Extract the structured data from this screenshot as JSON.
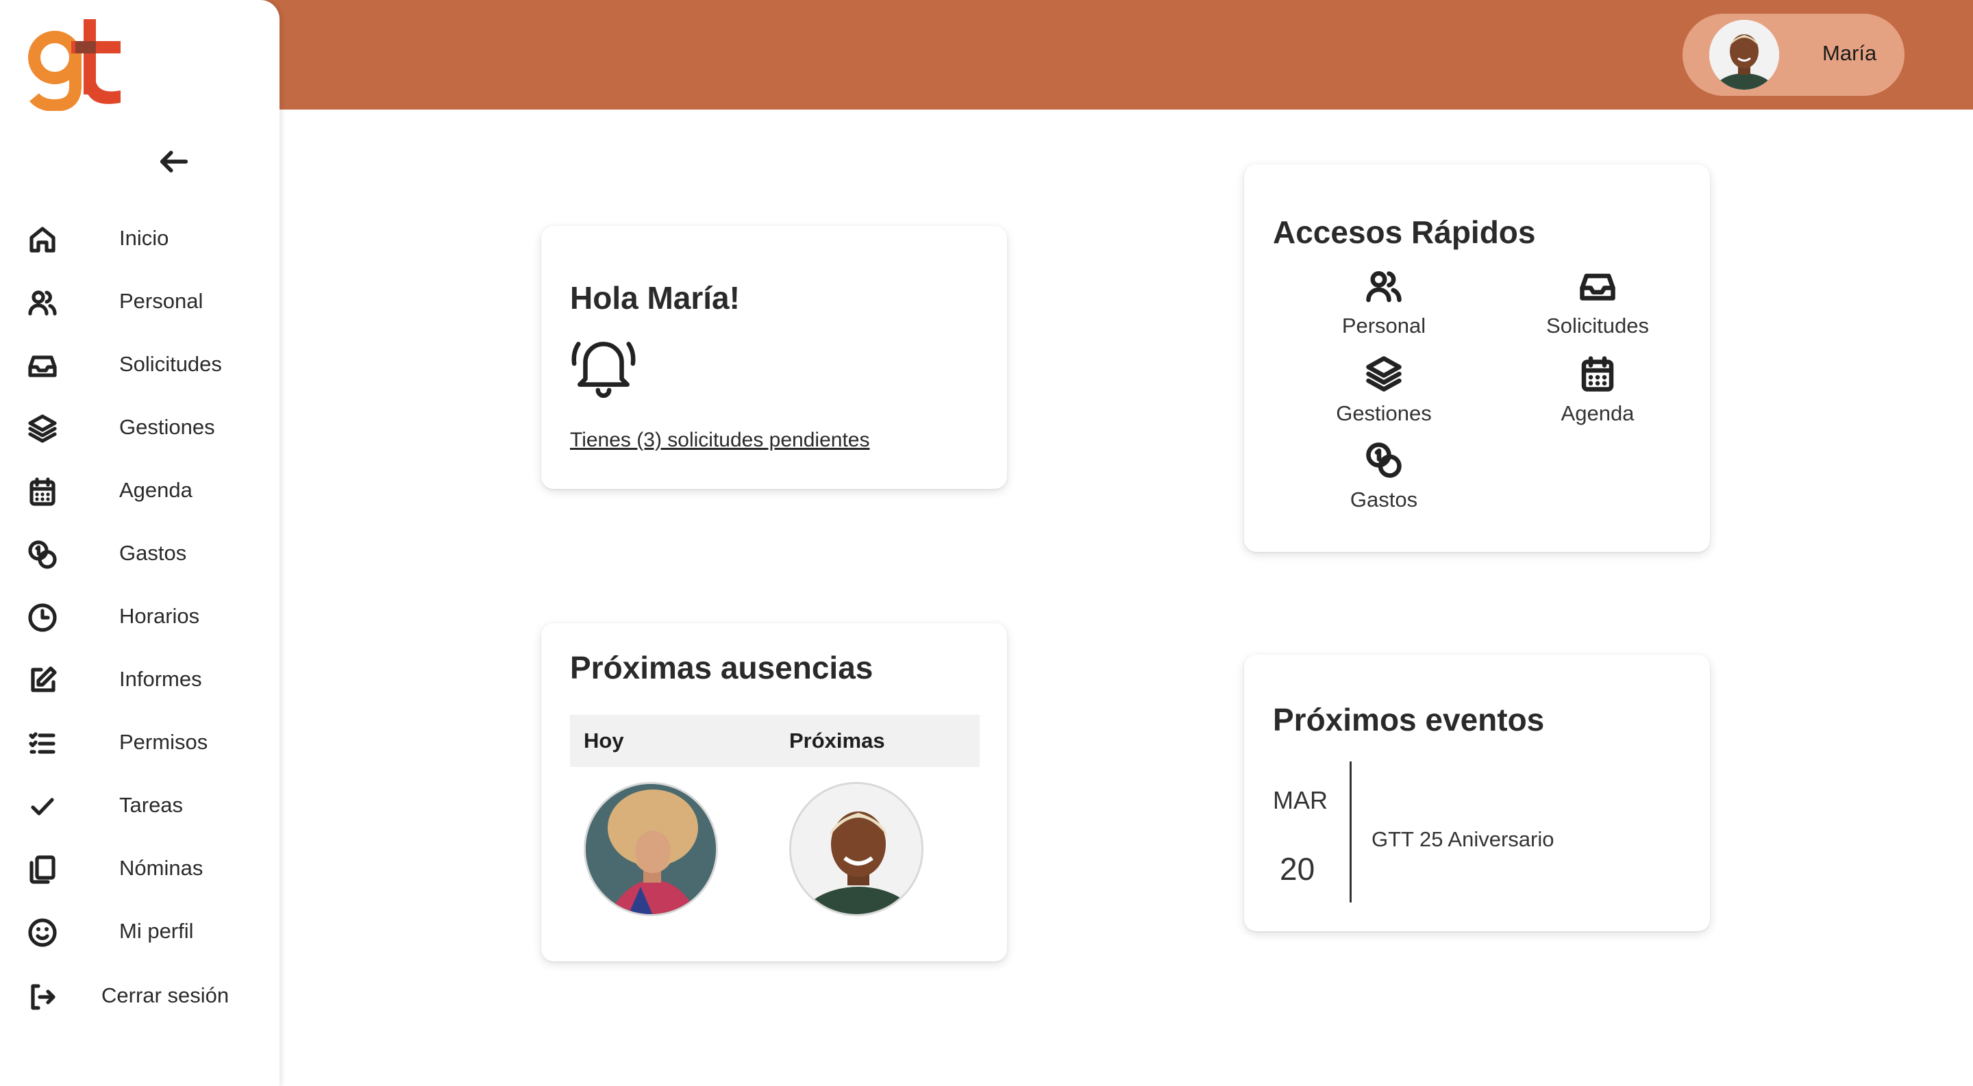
{
  "brand": {
    "logo_text": "gt",
    "colors": {
      "header": "#c26a43",
      "pill": "#e5a283",
      "logo_g": "#ee8a2f",
      "logo_t": "#e0462a"
    }
  },
  "header": {
    "user_name": "María"
  },
  "sidebar": {
    "back_icon": "arrow-left-icon",
    "items": [
      {
        "label": "Inicio",
        "icon": "home-icon"
      },
      {
        "label": "Personal",
        "icon": "users-icon"
      },
      {
        "label": "Solicitudes",
        "icon": "inbox-icon"
      },
      {
        "label": "Gestiones",
        "icon": "layers-icon"
      },
      {
        "label": "Agenda",
        "icon": "calendar-icon"
      },
      {
        "label": "Gastos",
        "icon": "coins-icon"
      },
      {
        "label": "Horarios",
        "icon": "clock-icon"
      },
      {
        "label": "Informes",
        "icon": "edit-icon"
      },
      {
        "label": "Permisos",
        "icon": "list-check-icon"
      },
      {
        "label": "Tareas",
        "icon": "check-icon"
      },
      {
        "label": "Nóminas",
        "icon": "copy-icon"
      },
      {
        "label": "Mi perfil",
        "icon": "smile-icon"
      },
      {
        "label": "Cerrar sesión",
        "icon": "logout-icon"
      }
    ]
  },
  "welcome": {
    "title": "Hola María!",
    "pending_link": "Tienes (3) solicitudes pendientes"
  },
  "quick_access": {
    "title": "Accesos Rápidos",
    "items": [
      {
        "label": "Personal",
        "icon": "users-icon"
      },
      {
        "label": "Solicitudes",
        "icon": "inbox-icon"
      },
      {
        "label": "Gestiones",
        "icon": "layers-icon"
      },
      {
        "label": "Agenda",
        "icon": "calendar-icon"
      },
      {
        "label": "Gastos",
        "icon": "coins-icon"
      }
    ]
  },
  "absences": {
    "title": "Próximas ausencias",
    "columns": [
      "Hoy",
      "Próximas"
    ]
  },
  "events": {
    "title": "Próximos eventos",
    "items": [
      {
        "month": "MAR",
        "day": "20",
        "name": "GTT 25 Aniversario"
      }
    ]
  }
}
